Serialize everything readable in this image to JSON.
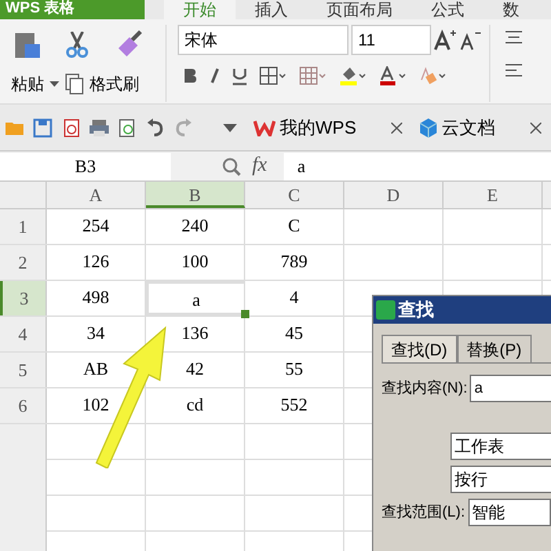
{
  "app_button": "WPS 表格",
  "tabs": [
    {
      "label": "开始",
      "selected": true
    },
    {
      "label": "插入",
      "selected": false
    },
    {
      "label": "页面布局",
      "selected": false
    },
    {
      "label": "公式",
      "selected": false
    },
    {
      "label": "数",
      "selected": false
    }
  ],
  "ribbon": {
    "paste": "粘贴",
    "format_painter": "格式刷",
    "font": "宋体",
    "size": "11"
  },
  "doc_tabs": [
    {
      "label": "我的WPS",
      "kind": "wps"
    },
    {
      "label": "云文档",
      "kind": "cloud"
    }
  ],
  "name_box": "B3",
  "function_label": "fx",
  "formula": "a",
  "columns": [
    {
      "label": "A",
      "selected": false
    },
    {
      "label": "B",
      "selected": true
    },
    {
      "label": "C",
      "selected": false
    },
    {
      "label": "D",
      "selected": false
    },
    {
      "label": "E",
      "selected": false
    }
  ],
  "rows": [
    {
      "label": "1",
      "selected": false,
      "cells": [
        "254",
        "240",
        "C",
        "",
        ""
      ]
    },
    {
      "label": "2",
      "selected": false,
      "cells": [
        "126",
        "100",
        "789",
        "",
        ""
      ]
    },
    {
      "label": "3",
      "selected": true,
      "cells": [
        "498",
        "a",
        "4",
        "",
        ""
      ]
    },
    {
      "label": "4",
      "selected": false,
      "cells": [
        "34",
        "136",
        "45",
        "",
        ""
      ]
    },
    {
      "label": "5",
      "selected": false,
      "cells": [
        "AB",
        "42",
        "55",
        "",
        ""
      ]
    },
    {
      "label": "6",
      "selected": false,
      "cells": [
        "102",
        "cd",
        "552",
        "",
        ""
      ]
    }
  ],
  "dialog": {
    "title": "查找",
    "tabs": [
      {
        "label": "查找(D)",
        "selected": true
      },
      {
        "label": "替换(P)",
        "selected": false
      }
    ],
    "find_label": "查找内容(N):",
    "find_value": "a",
    "options": [
      "工作表",
      "按行"
    ],
    "scope_label": "查找范围(L):",
    "scope_value": "智能"
  }
}
